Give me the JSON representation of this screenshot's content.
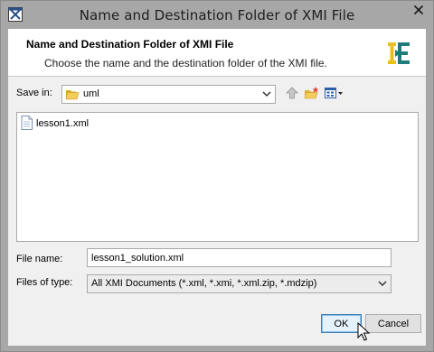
{
  "window": {
    "title": "Name and Destination Folder of XMI File",
    "app_icon": "app-window-icon",
    "close_icon": "close-icon"
  },
  "header": {
    "title": "Name and Destination Folder of XMI File",
    "description": "Choose the name and the destination folder of the XMI file.",
    "logo": "xmi-logo-icon"
  },
  "save_in": {
    "label": "Save in:",
    "value": "uml",
    "icon": "folder-icon"
  },
  "toolbar": {
    "up_icon": "up-one-level-icon",
    "new_folder_icon": "new-folder-icon",
    "view_menu_icon": "view-menu-icon"
  },
  "files": [
    {
      "name": "lesson1.xml",
      "icon": "file-icon"
    }
  ],
  "file_name": {
    "label": "File name:",
    "value": "lesson1_solution.xml"
  },
  "file_type": {
    "label": "Files of type:",
    "value": "All XMI Documents (*.xml, *.xmi, *.xml.zip, *.mdzip)"
  },
  "buttons": {
    "ok": "OK",
    "cancel": "Cancel"
  },
  "colors": {
    "titlebar": "#a7a7a7",
    "client": "#f0f0f0",
    "logo_yellow": "#e8c21a",
    "logo_teal": "#1f7a7a",
    "ok_border": "#3c7fb1"
  }
}
